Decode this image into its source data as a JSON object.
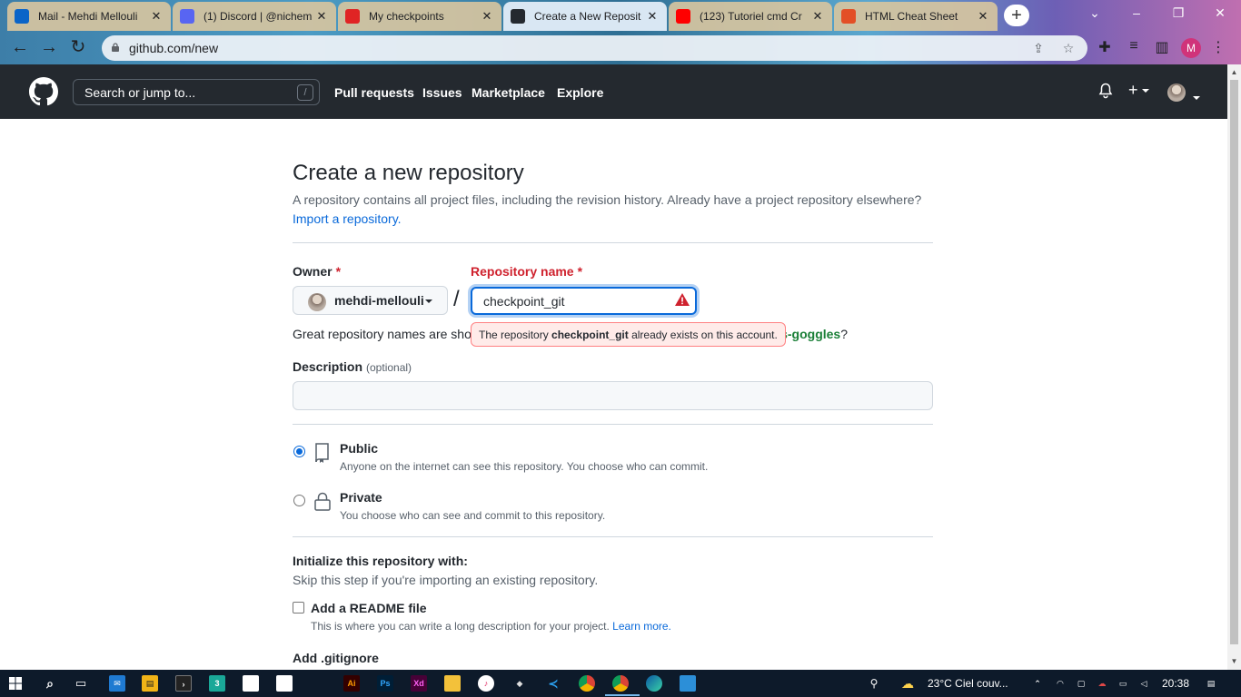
{
  "browser": {
    "tabs": [
      {
        "title": "Mail - Mehdi Mellouli",
        "icon": "outlook-icon",
        "color": "#0a64c8"
      },
      {
        "title": "(1) Discord | @nichem",
        "icon": "discord-icon",
        "color": "#5865f2"
      },
      {
        "title": "My checkpoints",
        "icon": "checkpoint-icon",
        "color": "#e02424"
      },
      {
        "title": "Create a New Reposit",
        "icon": "github-icon",
        "color": "#24292f",
        "active": true
      },
      {
        "title": "(123) Tutoriel cmd Cr",
        "icon": "youtube-icon",
        "color": "#ff0000"
      },
      {
        "title": "HTML Cheat Sheet",
        "icon": "html5-icon",
        "color": "#e34f26"
      }
    ],
    "url": "github.com/new",
    "profile_initial": "M"
  },
  "header": {
    "search_placeholder": "Search or jump to...",
    "search_shortcut": "/",
    "nav": [
      "Pull requests",
      "Issues",
      "Marketplace",
      "Explore"
    ],
    "plus": "+"
  },
  "page": {
    "title": "Create a new repository",
    "subtitle": "A repository contains all project files, including the revision history. Already have a project repository elsewhere?",
    "import_link": "Import a repository.",
    "owner_label": "Owner",
    "required_mark": "*",
    "owner_name": "mehdi-mellouli",
    "separator": "/",
    "repo_label": "Repository name",
    "repo_value": "checkpoint_git",
    "hint_prefix": "Great repository names are shor",
    "hint_suggestion": "ous-goggles",
    "hint_suffix": "?",
    "tooltip_prefix": "The repository",
    "tooltip_repo": "checkpoint_git",
    "tooltip_suffix": "already exists on this account.",
    "description_label": "Description",
    "description_optional": "(optional)",
    "description_value": "",
    "visibility": [
      {
        "title": "Public",
        "desc": "Anyone on the internet can see this repository. You choose who can commit.",
        "checked": true,
        "icon": "repo-icon"
      },
      {
        "title": "Private",
        "desc": "You choose who can see and commit to this repository.",
        "checked": false,
        "icon": "lock-icon"
      }
    ],
    "init_title": "Initialize this repository with:",
    "init_sub": "Skip this step if you're importing an existing repository.",
    "readme_label": "Add a README file",
    "readme_desc": "This is where you can write a long description for your project.",
    "readme_link": "Learn more.",
    "readme_checked": false,
    "gitignore_label": "Add .gitignore"
  },
  "taskbar": {
    "weather": "23°C  Ciel couv...",
    "time": "20:38",
    "apps": [
      "windows-icon",
      "search-icon",
      "taskview-icon",
      "mail-icon",
      "store-icon",
      "terminal-icon",
      "app-icon",
      "file-icon",
      "file-icon",
      "illustrator-icon",
      "photoshop-icon",
      "xd-icon",
      "explorer-icon",
      "itunes-icon",
      "game-icon",
      "vscode-icon",
      "chrome-icon",
      "chrome-icon",
      "edge-icon",
      "photos-icon"
    ]
  },
  "colors": {
    "accent": "#0969da",
    "danger": "#cf222e",
    "success": "#1a7f37",
    "header_bg": "#24292f"
  }
}
